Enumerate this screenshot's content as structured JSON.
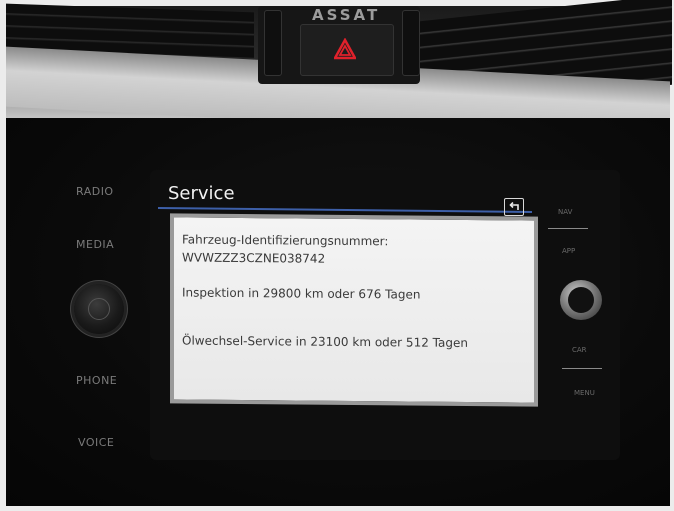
{
  "vehicle": {
    "brand_fragment": "ASSAT"
  },
  "physical_controls": {
    "left": [
      "RADIO",
      "MEDIA",
      "PHONE",
      "VOICE"
    ],
    "right": [
      "NAV",
      "APP",
      "CAR",
      "MENU"
    ]
  },
  "screen": {
    "title": "Service",
    "vin_label": "Fahrzeug-Identifizierungsnummer:",
    "vin_value": "WVWZZZ3CZNE038742",
    "inspection": "Inspektion in 29800 km oder 676 Tagen",
    "oil_service": "Ölwechsel-Service in 23100 km oder 512 Tagen",
    "back_icon": "back-arrow-icon"
  },
  "colors": {
    "title_underline": "#3d5fa8",
    "hazard_red": "#e0212b",
    "panel_background": "#f0f0f0",
    "panel_text": "#3a3a3a"
  }
}
